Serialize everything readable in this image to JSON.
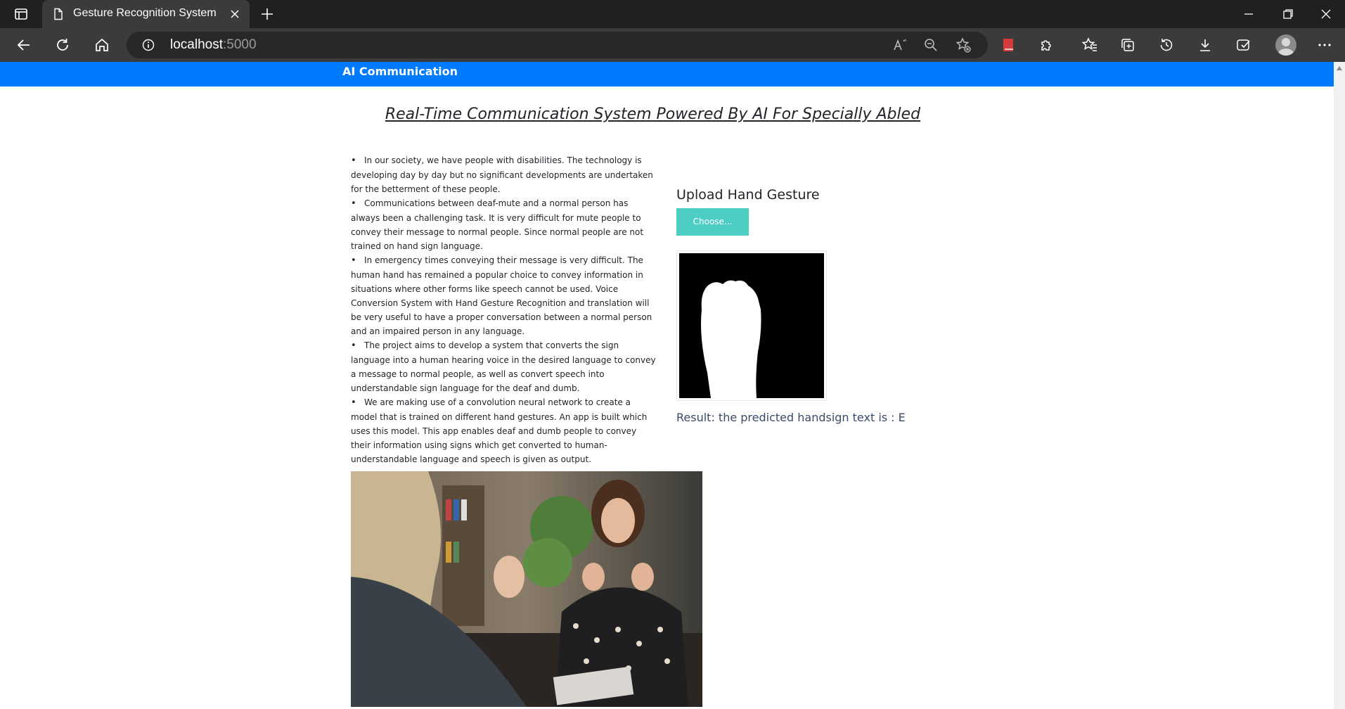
{
  "browser": {
    "tab_title": "Gesture Recognition System",
    "url_host": "localhost",
    "url_port": ":5000"
  },
  "navbar": {
    "brand": "AI Communication"
  },
  "main": {
    "heading": "Real-Time Communication System Powered By AI For Specially Abled",
    "bullets": [
      "In our society, we have people with disabilities. The technology is developing day by day but no significant developments are undertaken for the betterment of these people.",
      "Communications between deaf-mute and a normal person has always been a challenging task. It is very difficult for mute people to convey their message to normal people. Since normal people are not trained on hand sign language.",
      "In emergency times conveying their message is very difficult. The human hand has remained a popular choice to convey information in situations where other forms like speech cannot be used. Voice Conversion System with Hand Gesture Recognition and translation will be very useful to have a proper conversation between a normal person and an impaired person in any language.",
      "The project aims to develop a system that converts the sign language into a human hearing voice in the desired language to convey a message to normal people, as well as convert speech into understandable sign language for the deaf and dumb.",
      "We are making use of a convolution neural network to create a model that is trained on different hand gestures. An app is built which uses this model. This app enables deaf and dumb people to convey their information using signs which get converted to human-understandable language and speech is given as output."
    ]
  },
  "upload": {
    "title": "Upload Hand Gesture",
    "choose_label": "Choose...",
    "result_text": "Result: the predicted handsign text is : E"
  },
  "colors": {
    "navbar": "#007bff",
    "choose_button": "#4ecdc4",
    "result_text": "#3b4a6b"
  },
  "icons": {
    "sidebar_toggle": "sidebar-toggle-icon",
    "tab": "page-icon",
    "close": "close-icon",
    "new_tab": "plus-icon",
    "back": "back-arrow-icon",
    "refresh": "refresh-icon",
    "home": "home-icon",
    "info": "info-icon",
    "read_aloud": "read-aloud-icon",
    "zoom": "zoom-out-icon",
    "favorite_add": "star-add-icon",
    "extension_red": "red-book-icon",
    "extensions": "puzzle-icon",
    "favorites": "favorites-icon",
    "collections": "collections-icon",
    "history": "history-icon",
    "downloads": "download-icon",
    "performance": "performance-icon",
    "profile": "profile-icon",
    "menu": "more-icon"
  }
}
